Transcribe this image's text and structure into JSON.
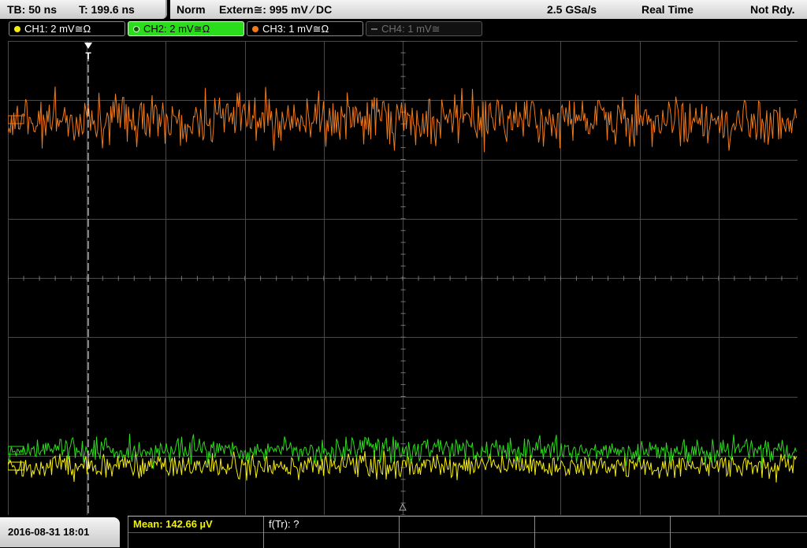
{
  "status": {
    "timebase": "TB: 50 ns",
    "trigger_time": "T: 199.6 ns",
    "mode": "Norm",
    "trigger_source": "Extern≅: 995 mV ⁄ DC",
    "sample_rate": "2.5 GSa/s",
    "acq_mode": "Real Time",
    "state": "Not Rdy."
  },
  "channels": [
    {
      "id": "ch1",
      "label": "CH1: 2 mV≅Ω",
      "color": "#f4ee10",
      "active": false,
      "enabled": true
    },
    {
      "id": "ch2",
      "label": "CH2: 2 mV≅Ω",
      "color": "#2bdc1c",
      "active": true,
      "enabled": true
    },
    {
      "id": "ch3",
      "label": "CH3: 1 mV≅Ω",
      "color": "#f07a1a",
      "active": false,
      "enabled": true
    },
    {
      "id": "ch4",
      "label": "CH4: 1 mV≅",
      "color": "#777777",
      "active": false,
      "enabled": false
    }
  ],
  "markers": {
    "trigger_label": "T"
  },
  "measurements": {
    "mean": "Mean: 142.66 µV",
    "freq": "f(Tr): ?"
  },
  "footer": {
    "datetime": "2016-08-31 18:01"
  },
  "colors": {
    "grid": "#4a4a4a",
    "trace_ch1": "#f4ee10",
    "trace_ch2": "#2bdc1c",
    "trace_ch3": "#f07a1a"
  }
}
